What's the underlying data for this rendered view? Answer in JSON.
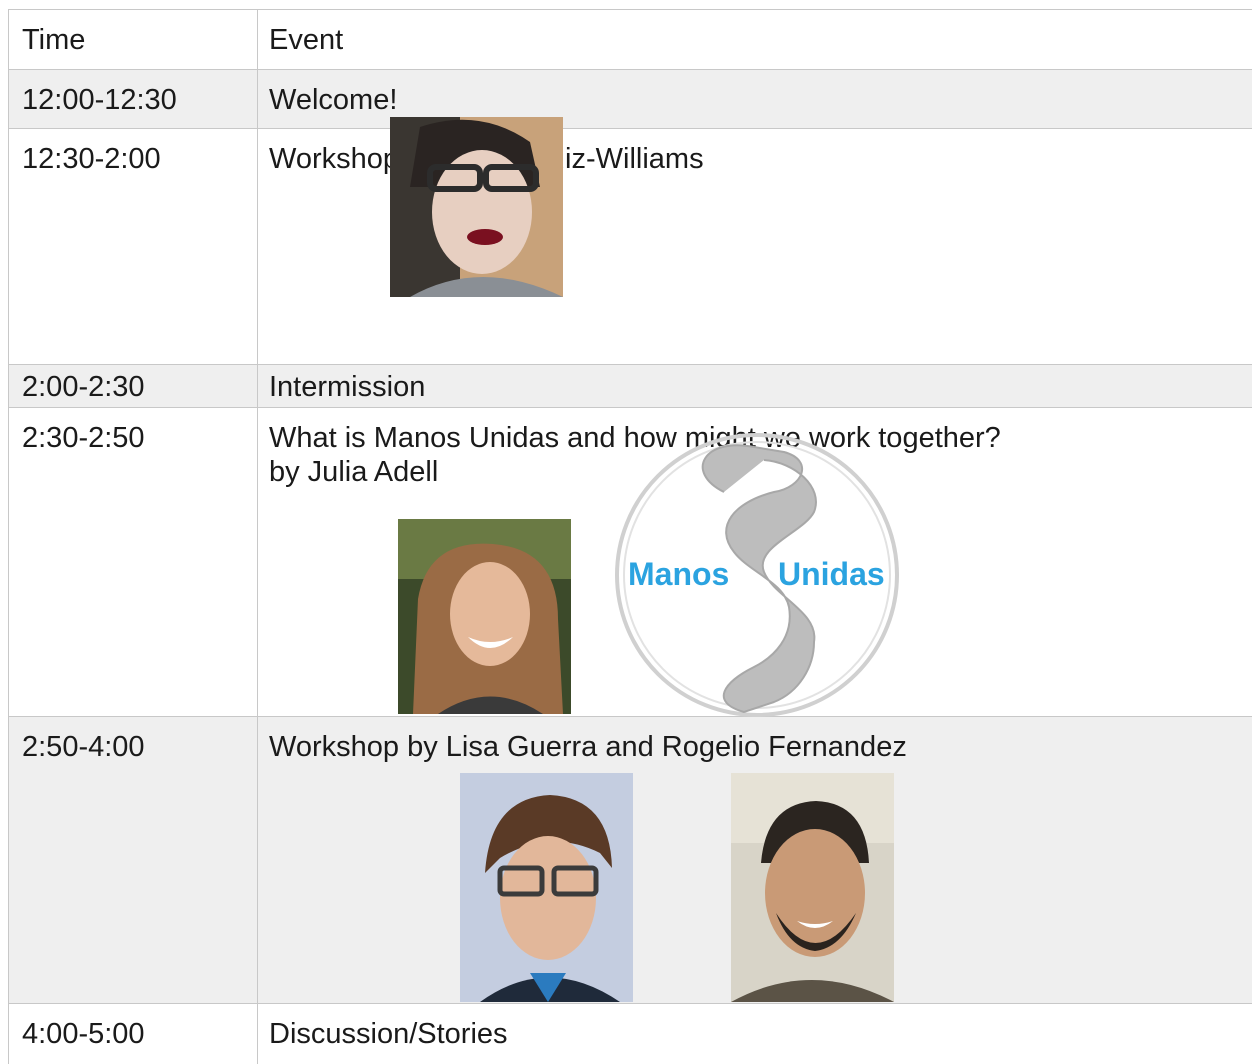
{
  "header": {
    "time": "Time",
    "event": "Event"
  },
  "rows": [
    {
      "time": "12:00-12:30",
      "event": "Welcome!"
    },
    {
      "time": "12:30-2:00",
      "event": "Workshop by Elena Ruiz-Williams"
    },
    {
      "time": "2:00-2:30",
      "event": "Intermission"
    },
    {
      "time": "2:30-2:50",
      "event": "What is Manos Unidas and how might we work together?",
      "event_line2": "by Julia Adell"
    },
    {
      "time": "2:50-4:00",
      "event": "Workshop by Lisa Guerra and Rogelio Fernandez"
    },
    {
      "time": "4:00-5:00",
      "event": "Discussion/Stories"
    }
  ],
  "logo": {
    "word1": "Manos",
    "word2": "Unidas"
  },
  "colors": {
    "row_alt": "#efefef",
    "border": "#c8c8c8",
    "logo_blue": "#2ba3e0",
    "logo_gray": "#b9b9b9"
  }
}
